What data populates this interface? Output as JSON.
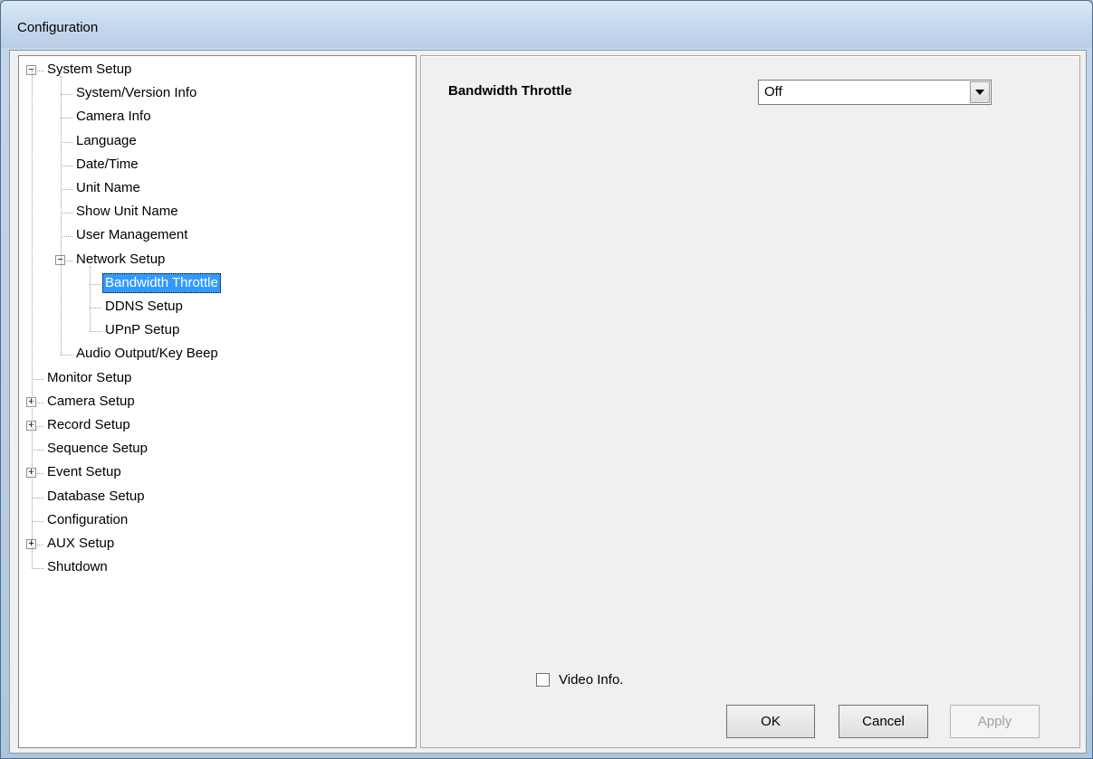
{
  "window": {
    "title": "Configuration"
  },
  "tree": [
    {
      "label": "System Setup",
      "level": 0,
      "expander": "minus"
    },
    {
      "label": "System/Version Info",
      "level": 1
    },
    {
      "label": "Camera Info",
      "level": 1
    },
    {
      "label": "Language",
      "level": 1
    },
    {
      "label": "Date/Time",
      "level": 1
    },
    {
      "label": "Unit Name",
      "level": 1
    },
    {
      "label": "Show Unit Name",
      "level": 1
    },
    {
      "label": "User Management",
      "level": 1
    },
    {
      "label": "Network Setup",
      "level": 1,
      "expander": "minus"
    },
    {
      "label": "Bandwidth Throttle",
      "level": 2,
      "selected": true
    },
    {
      "label": "DDNS Setup",
      "level": 2
    },
    {
      "label": "UPnP Setup",
      "level": 2
    },
    {
      "label": "Audio Output/Key Beep",
      "level": 1
    },
    {
      "label": "Monitor Setup",
      "level": 0
    },
    {
      "label": "Camera Setup",
      "level": 0,
      "expander": "plus"
    },
    {
      "label": "Record Setup",
      "level": 0,
      "expander": "plus"
    },
    {
      "label": "Sequence Setup",
      "level": 0
    },
    {
      "label": "Event Setup",
      "level": 0,
      "expander": "plus"
    },
    {
      "label": "Database Setup",
      "level": 0
    },
    {
      "label": "Configuration",
      "level": 0
    },
    {
      "label": "AUX Setup",
      "level": 0,
      "expander": "plus"
    },
    {
      "label": "Shutdown",
      "level": 0
    }
  ],
  "panel": {
    "bandwidth_label": "Bandwidth Throttle",
    "bandwidth_value": "Off",
    "video_info_label": "Video Info.",
    "video_info_checked": false
  },
  "buttons": {
    "ok": "OK",
    "cancel": "Cancel",
    "apply": "Apply"
  }
}
